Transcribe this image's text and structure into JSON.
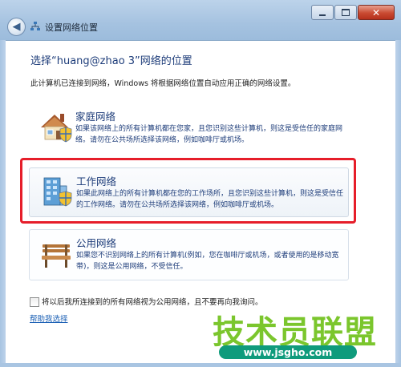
{
  "window": {
    "title": "设置网络位置",
    "controls": [
      "minimize-icon",
      "maximize-icon",
      "close-icon"
    ]
  },
  "heading": "选择“huang@zhao 3”网络的位置",
  "description": "此计算机已连接到网络，Windows 将根据网络位置自动应用正确的网络设置。",
  "options": [
    {
      "title": "家庭网络",
      "description": "如果该网络上的所有计算机都在您家，且您识别这些计算机，则这是受信任的家庭网络。请勿在公共场所选择该网络，例如咖啡厅或机场。",
      "icon": "house-icon"
    },
    {
      "title": "工作网络",
      "description": "如果此网络上的所有计算机都在您的工作场所，且您识别这些计算机，则这是受信任的工作网络。请勿在公共场所选择该网络，例如咖啡厅或机场。",
      "icon": "office-building-icon"
    },
    {
      "title": "公用网络",
      "description": "如果您不识别网络上的所有计算机(例如，您在咖啡厅或机场，或者使用的是移动宽带)，则这是公用网络，不受信任。",
      "icon": "park-bench-icon"
    }
  ],
  "checkbox": {
    "label": "将以后我所连接到的所有网络视为公用网络，且不要再向我询问。",
    "checked": false
  },
  "help_link": "帮助我选择",
  "watermark": {
    "main": "技术员联盟",
    "url": "www.jsgho.com"
  },
  "colors": {
    "highlight": "#e61e2a",
    "link": "#1a5fb4",
    "heading": "#1e3d7a",
    "watermark": "#7bc62d"
  }
}
